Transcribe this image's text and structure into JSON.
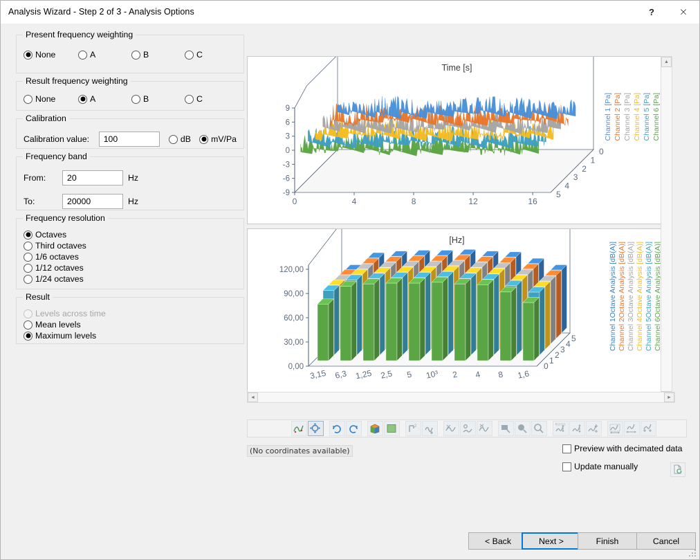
{
  "window": {
    "title": "Analysis Wizard - Step 2 of 3 - Analysis Options",
    "help_glyph": "?",
    "close_glyph": "×"
  },
  "options": {
    "present_weighting": {
      "title": "Present frequency weighting",
      "items": [
        {
          "label": "None",
          "checked": true
        },
        {
          "label": "A",
          "checked": false
        },
        {
          "label": "B",
          "checked": false
        },
        {
          "label": "C",
          "checked": false
        }
      ]
    },
    "result_weighting": {
      "title": "Result frequency weighting",
      "items": [
        {
          "label": "None",
          "checked": false
        },
        {
          "label": "A",
          "checked": true
        },
        {
          "label": "B",
          "checked": false
        },
        {
          "label": "C",
          "checked": false
        }
      ]
    },
    "calibration": {
      "title": "Calibration",
      "value_label": "Calibration value:",
      "value": "100",
      "units": [
        {
          "label": "dB",
          "checked": false
        },
        {
          "label": "mV/Pa",
          "checked": true
        }
      ]
    },
    "frequency_band": {
      "title": "Frequency band",
      "from_label": "From:",
      "from_value": "20",
      "to_label": "To:",
      "to_value": "20000",
      "unit": "Hz"
    },
    "frequency_resolution": {
      "title": "Frequency resolution",
      "items": [
        {
          "label": "Octaves",
          "checked": true
        },
        {
          "label": "Third octaves",
          "checked": false
        },
        {
          "label": "1/6 octaves",
          "checked": false
        },
        {
          "label": "1/12 octaves",
          "checked": false
        },
        {
          "label": "1/24 octaves",
          "checked": false
        }
      ]
    },
    "result": {
      "title": "Result",
      "items": [
        {
          "label": "Levels across time",
          "checked": false,
          "disabled": true
        },
        {
          "label": "Mean levels",
          "checked": false,
          "disabled": false
        },
        {
          "label": "Maximum levels",
          "checked": true,
          "disabled": false
        }
      ]
    }
  },
  "chart_data": [
    {
      "type": "line",
      "id": "time-waveform-3d",
      "title": "Time [s]",
      "xlabel": "",
      "ylabel": "",
      "xticks": [
        "0",
        "4",
        "8",
        "12",
        "16"
      ],
      "yticks": [
        "9",
        "6",
        "3",
        "0",
        "-3",
        "-6",
        "-9"
      ],
      "ylim": [
        -9,
        9
      ],
      "xlim": [
        0,
        16
      ],
      "zticks": [
        "0",
        "1",
        "2",
        "3",
        "4",
        "5"
      ],
      "grid": false,
      "legend_position": "right",
      "series": [
        {
          "name": "Channel 1 [Pa]",
          "color": "#4a90d9"
        },
        {
          "name": "Channel 2 [Pa]",
          "color": "#e8762c"
        },
        {
          "name": "Channel 3 [Pa]",
          "color": "#a6a6a6"
        },
        {
          "name": "Channel 4 [Pa]",
          "color": "#f5bc21"
        },
        {
          "name": "Channel 5 [Pa]",
          "color": "#40a0c0"
        },
        {
          "name": "Channel 6 [Pa]",
          "color": "#5aa544"
        }
      ]
    },
    {
      "type": "bar",
      "id": "octave-analysis-3d",
      "title": "[Hz]",
      "xlabel": "",
      "ylabel": "",
      "categories": [
        "3,15",
        "6,3",
        "1,25",
        "2,5",
        "5",
        "10³",
        "2",
        "4",
        "8",
        "1,6"
      ],
      "yticks": [
        "120,00",
        "90,00",
        "60,00",
        "30,00",
        "0,00"
      ],
      "ylim": [
        0,
        120
      ],
      "zticks": [
        "0",
        "1",
        "2",
        "3",
        "4",
        "5"
      ],
      "grid": false,
      "legend_position": "right",
      "series": [
        {
          "name": "Channel 1Octave Analysis [dB(A)]",
          "color": "#3a7fc1",
          "values": [
            78,
            93,
            95,
            96,
            96,
            97,
            95,
            94,
            86,
            78
          ]
        },
        {
          "name": "Channel 2Octave Analysis [dB(A)]",
          "color": "#e8762c",
          "values": [
            79,
            93,
            95,
            96,
            96,
            97,
            95,
            94,
            86,
            78
          ]
        },
        {
          "name": "Channel 3Octave Analysis [dB(A)]",
          "color": "#a6a6a6",
          "values": [
            79,
            93,
            95,
            96,
            96,
            97,
            95,
            94,
            86,
            78
          ]
        },
        {
          "name": "Channel 4Octave Analysis [dB(A)]",
          "color": "#f5bc21",
          "values": [
            80,
            93,
            95,
            96,
            96,
            97,
            95,
            94,
            86,
            78
          ]
        },
        {
          "name": "Channel 5Octave Analysis [dB(A)]",
          "color": "#40a0c0",
          "values": [
            80,
            93,
            95,
            96,
            96,
            97,
            95,
            94,
            86,
            78
          ]
        },
        {
          "name": "Channel 6Octave Analysis [dB(A)]",
          "color": "#5aa544",
          "values": [
            70,
            92,
            95,
            96,
            96,
            97,
            95,
            94,
            85,
            72
          ]
        }
      ]
    }
  ],
  "toolbar": {
    "buttons": [
      {
        "name": "curve-edit-icon",
        "selected": false,
        "enabled": true
      },
      {
        "name": "fit-to-window-icon",
        "selected": true,
        "enabled": true
      },
      {
        "name": "rotate-cw-icon",
        "selected": false,
        "enabled": true
      },
      {
        "name": "rotate-ccw-icon",
        "selected": false,
        "enabled": true
      },
      {
        "name": "3d-view-icon",
        "selected": false,
        "enabled": true
      },
      {
        "name": "2d-view-icon",
        "selected": false,
        "enabled": true
      },
      {
        "name": "cursor-single-icon",
        "selected": false,
        "enabled": false
      },
      {
        "name": "cursor-harmonic-icon",
        "selected": false,
        "enabled": false
      },
      {
        "name": "cursor-delta-icon",
        "selected": false,
        "enabled": false
      },
      {
        "name": "cursor-peak-icon",
        "selected": false,
        "enabled": false
      },
      {
        "name": "cursor-band-icon",
        "selected": false,
        "enabled": false
      },
      {
        "name": "zoom-rect-icon",
        "selected": false,
        "enabled": false
      },
      {
        "name": "zoom-in-icon",
        "selected": false,
        "enabled": false
      },
      {
        "name": "zoom-out-icon",
        "selected": false,
        "enabled": false
      },
      {
        "name": "scale-y-auto-icon",
        "selected": false,
        "enabled": false
      },
      {
        "name": "scale-y-fit-icon",
        "selected": false,
        "enabled": false
      },
      {
        "name": "scale-y-expand-icon",
        "selected": false,
        "enabled": false
      },
      {
        "name": "scale-x-auto-icon",
        "selected": false,
        "enabled": false
      },
      {
        "name": "scale-x-fit-icon",
        "selected": false,
        "enabled": false
      },
      {
        "name": "scale-x-expand-icon",
        "selected": false,
        "enabled": false
      }
    ]
  },
  "status": {
    "coordinates": "(No coordinates available)"
  },
  "checkboxes": [
    {
      "label": "Preview with decimated data",
      "checked": false
    },
    {
      "label": "Update manually",
      "checked": false
    }
  ],
  "buttons": {
    "back": "< Back",
    "next": "Next >",
    "finish": "Finish",
    "cancel": "Cancel"
  }
}
